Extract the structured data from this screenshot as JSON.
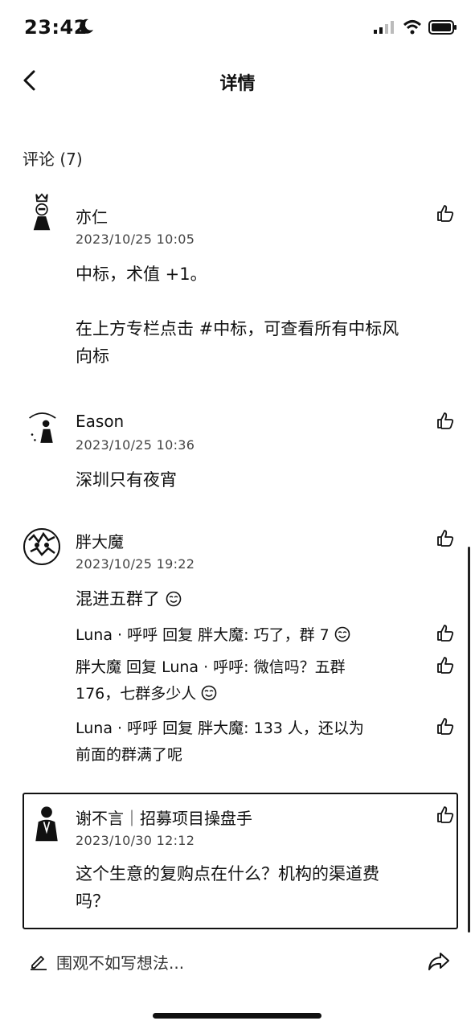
{
  "status": {
    "time": "23:42"
  },
  "nav": {
    "title": "详情"
  },
  "section": {
    "title": "评论 (7)"
  },
  "comments": [
    {
      "name": "亦仁",
      "time": "2023/10/25 10:05",
      "line1": "中标，术值 +1。",
      "line2": "在上方专栏点击 #中标，可查看所有中标风",
      "line3": "向标"
    },
    {
      "name": "Eason",
      "time": "2023/10/25 10:36",
      "line1": "深圳只有夜宵"
    },
    {
      "name": "胖大魔",
      "time": "2023/10/25 19:22",
      "line1": "混进五群了"
    },
    {
      "name": "谢不言｜招募项目操盘手",
      "time": "2023/10/30 12:12",
      "line1": "这个生意的复购点在什么？机构的渠道费",
      "line2": "吗？"
    }
  ],
  "replies": [
    {
      "line1": "Luna · 呼呼 回复 胖大魔: 巧了，群 7"
    },
    {
      "line1": "胖大魔 回复 Luna · 呼呼: 微信吗？五群",
      "line2": "176，七群多少人"
    },
    {
      "line1": "Luna · 呼呼 回复 胖大魔: 133 人，还以为",
      "line2": "前面的群满了呢"
    }
  ],
  "bottom": {
    "placeholder": "围观不如写想法..."
  }
}
